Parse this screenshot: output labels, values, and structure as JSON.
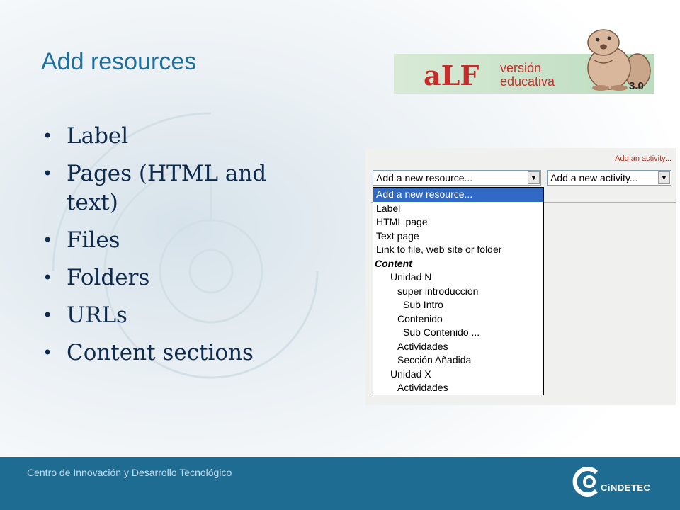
{
  "slide": {
    "title": "Add resources",
    "bullets": [
      "Label",
      "Pages (HTML and text)",
      "Files",
      "Folders",
      "URLs",
      "Content sections"
    ]
  },
  "logo": {
    "name": "aLF",
    "line1": "versión",
    "line2": "educativa",
    "version": "3.0",
    "mascot_icon": "beaver-icon"
  },
  "screenshot": {
    "add_activity_link": "Add an activity...",
    "resource_select": "Add a new resource...",
    "activity_select": "Add a new activity...",
    "dropdown_options": [
      {
        "label": "Add a new resource...",
        "style": "highlight"
      },
      {
        "label": "Label",
        "style": "item"
      },
      {
        "label": "HTML page",
        "style": "item"
      },
      {
        "label": "Text page",
        "style": "item"
      },
      {
        "label": "Link to file, web site or folder",
        "style": "item"
      },
      {
        "label": "Content",
        "style": "group"
      },
      {
        "label": "Unidad N",
        "style": "i1"
      },
      {
        "label": "super introducción",
        "style": "i2"
      },
      {
        "label": "Sub Intro",
        "style": "i3"
      },
      {
        "label": "Contenido",
        "style": "i2"
      },
      {
        "label": "Sub Contenido ...",
        "style": "i3"
      },
      {
        "label": "Actividades",
        "style": "i2"
      },
      {
        "label": "Sección Añadida",
        "style": "i2"
      },
      {
        "label": "Unidad X",
        "style": "i1"
      },
      {
        "label": "Actividades",
        "style": "i2"
      }
    ]
  },
  "footer": {
    "text": "Centro de Innovación y Desarrollo Tecnológico",
    "brand": "CiNDETEC",
    "logo_icon": "cindetec-logo-icon"
  },
  "colors": {
    "title": "#1d6f9e",
    "bullet_text": "#0e2a4d",
    "footer": "#1f6c93",
    "highlight": "#3169c6",
    "logo_red": "#c62d2a"
  }
}
